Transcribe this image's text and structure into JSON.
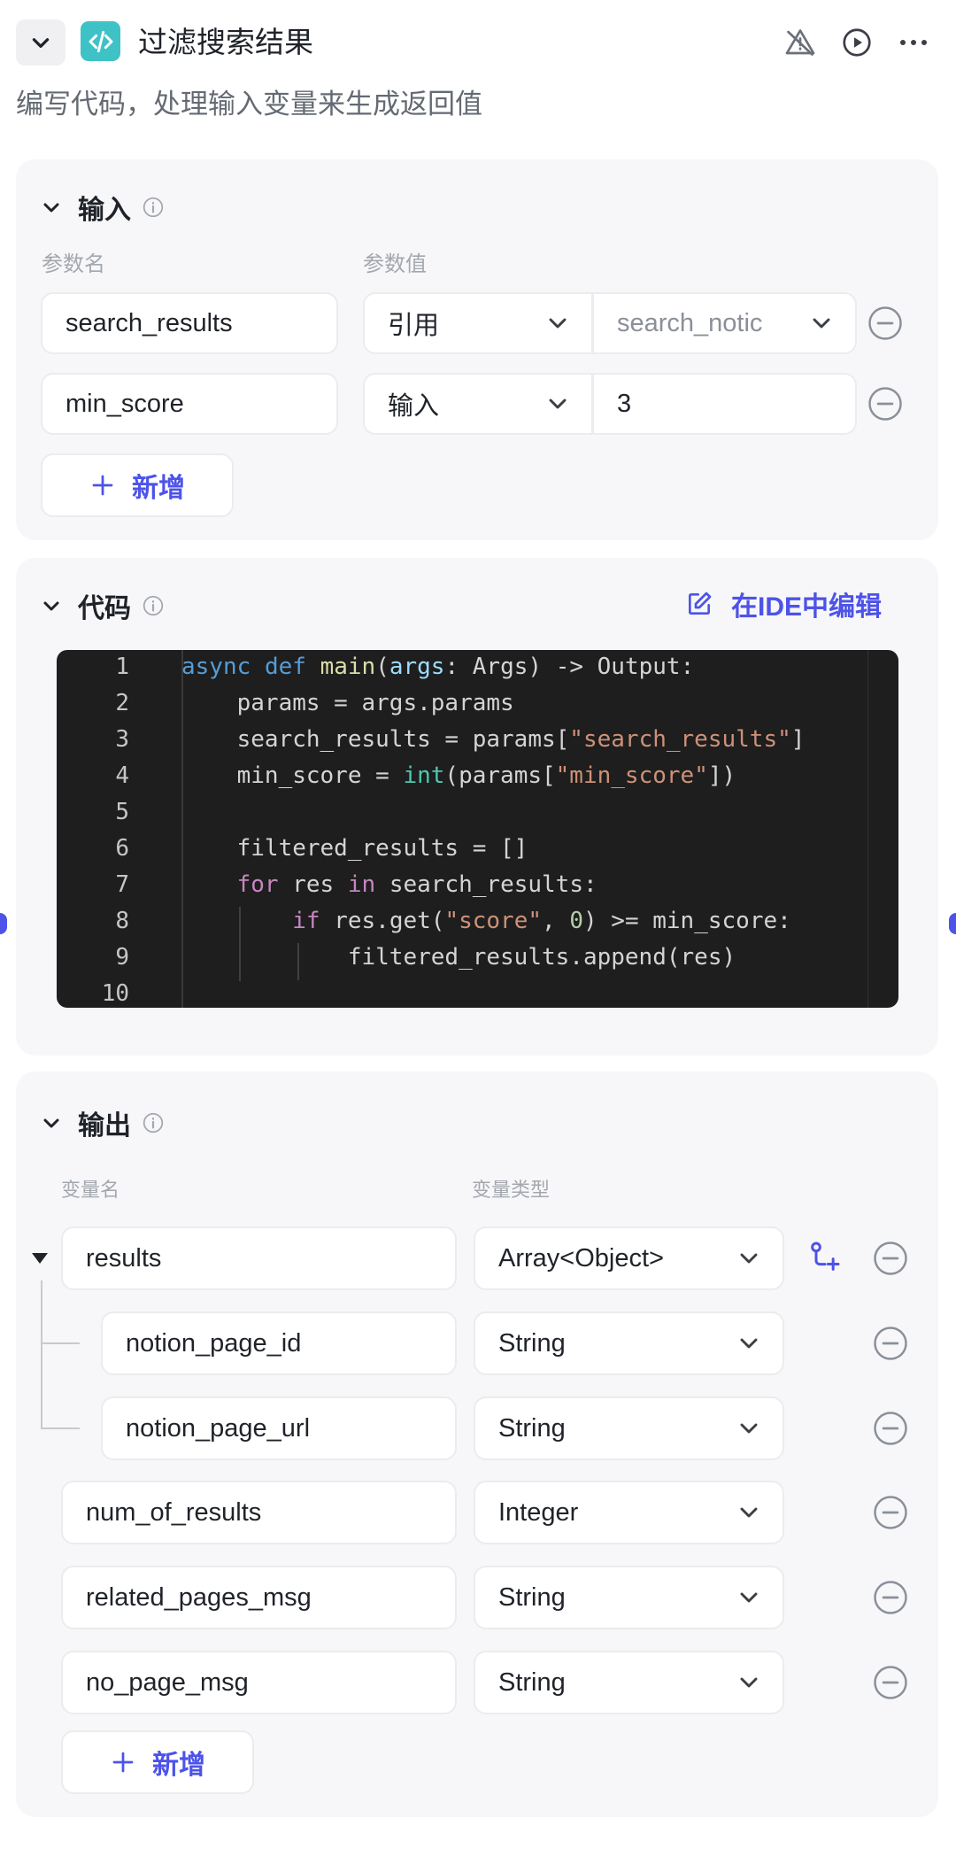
{
  "node": {
    "title": "过滤搜索结果",
    "description": "编写代码，处理输入变量来生成返回值",
    "icon": "code-icon"
  },
  "input": {
    "title": "输入",
    "col_name": "参数名",
    "col_value": "参数值",
    "rows": [
      {
        "name": "search_results",
        "mode": "引用",
        "value": "search_notic"
      },
      {
        "name": "min_score",
        "mode": "输入",
        "value": "3"
      }
    ],
    "add_label": "新增"
  },
  "code": {
    "title": "代码",
    "ide_label": "在IDE中编辑",
    "line_numbers": [
      "1",
      "2",
      "3",
      "4",
      "5",
      "6",
      "7",
      "8",
      "9",
      "10"
    ],
    "lines": [
      "async def main(args: Args) -> Output:",
      "    params = args.params",
      "    search_results = params[\"search_results\"]",
      "    min_score = int(params[\"min_score\"])",
      "",
      "    filtered_results = []",
      "    for res in search_results:",
      "        if res.get(\"score\", 0) >= min_score:",
      "            filtered_results.append(res)",
      ""
    ]
  },
  "output": {
    "title": "输出",
    "col_name": "变量名",
    "col_type": "变量类型",
    "rows": [
      {
        "name": "results",
        "type": "Array<Object>"
      },
      {
        "name": "notion_page_id",
        "type": "String"
      },
      {
        "name": "notion_page_url",
        "type": "String"
      },
      {
        "name": "num_of_results",
        "type": "Integer"
      },
      {
        "name": "related_pages_msg",
        "type": "String"
      },
      {
        "name": "no_page_msg",
        "type": "String"
      }
    ],
    "add_label": "新增"
  },
  "colors": {
    "accent": "#4d53e8",
    "node_icon_bg": "#3ec2c6",
    "panel_bg": "#f7f7f9",
    "editor_bg": "#1e1e1e"
  }
}
